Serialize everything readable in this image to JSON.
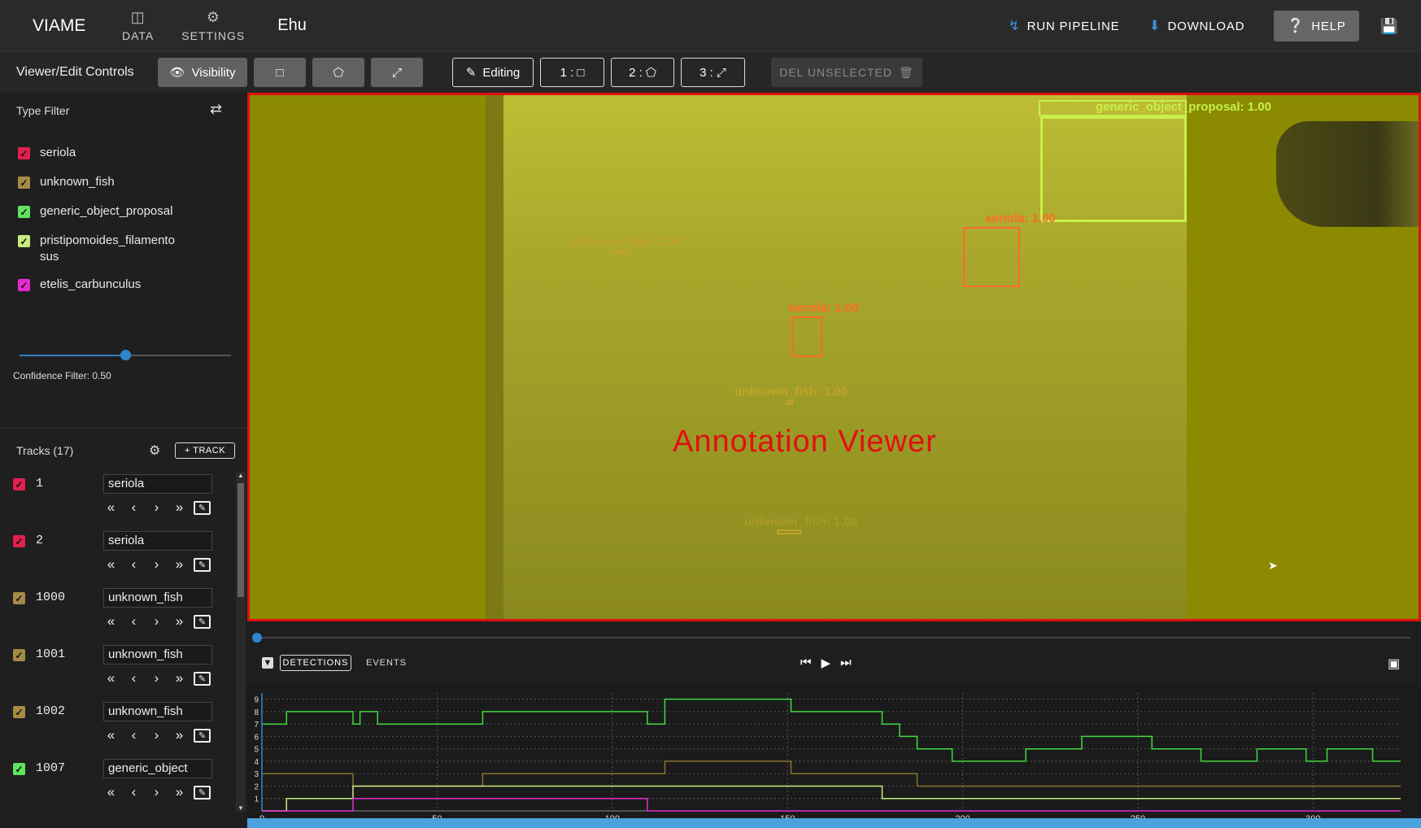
{
  "topbar": {
    "brand": "VIAME",
    "nav": [
      {
        "label": "DATA",
        "icon": "database-icon"
      },
      {
        "label": "SETTINGS",
        "icon": "gear-icon"
      }
    ],
    "dataset_name": "Ehu",
    "run_pipeline": "RUN PIPELINE",
    "download": "DOWNLOAD",
    "help": "HELP"
  },
  "controls": {
    "title": "Viewer/Edit Controls",
    "visibility": "Visibility",
    "editing": "Editing",
    "mode_1": "1 :",
    "mode_2": "2 :",
    "mode_3": "3 :",
    "delete_unselected": "DEL UNSELECTED"
  },
  "type_filter": {
    "title": "Type Filter",
    "types": [
      {
        "label": "seriola",
        "color": "#e0204f",
        "checked": true
      },
      {
        "label": "unknown_fish",
        "color": "#a58a45",
        "checked": true
      },
      {
        "label": "generic_object_proposal",
        "color": "#5fe35f",
        "checked": true
      },
      {
        "label": "pristipomoides_filamento sus",
        "color": "#c6ec7c",
        "checked": true
      },
      {
        "label": "etelis_carbunculus",
        "color": "#e62ccf",
        "checked": true
      }
    ],
    "confidence_label": "Confidence Filter: 0.50",
    "confidence_value": 0.5
  },
  "tracks": {
    "title": "Tracks (17)",
    "add_label": "+ TRACK",
    "items": [
      {
        "id": "1",
        "type": "seriola",
        "color": "#e0204f"
      },
      {
        "id": "2",
        "type": "seriola",
        "color": "#e0204f"
      },
      {
        "id": "1000",
        "type": "unknown_fish",
        "color": "#a58a45"
      },
      {
        "id": "1001",
        "type": "unknown_fish",
        "color": "#a58a45"
      },
      {
        "id": "1002",
        "type": "unknown_fish",
        "color": "#a58a45"
      },
      {
        "id": "1007",
        "type": "generic_object",
        "color": "#5fe35f"
      }
    ]
  },
  "viewer": {
    "watermark": "Annotation Viewer",
    "detections": [
      {
        "label": "generic_object_proposal: 1.00",
        "color": "#c7f04a"
      },
      {
        "label": "seriola: 1.00",
        "color": "#ff6a2b"
      },
      {
        "label": "unknown_fish: 1.00",
        "color": "#c4a22a"
      },
      {
        "label": "seriola: 1.00",
        "color": "#ff6a2b"
      },
      {
        "label": "unknown_fish: 1.00",
        "color": "#c4a22a"
      },
      {
        "label": "unknown_fish: 1.00",
        "color": "#c4a22a"
      }
    ]
  },
  "timeline": {
    "tab_detections": "DETECTIONS",
    "tab_events": "EVENTS",
    "y_ticks": [
      "1",
      "2",
      "3",
      "4",
      "5",
      "6",
      "7",
      "8",
      "9"
    ],
    "x_ticks": [
      "0",
      "50",
      "100",
      "150",
      "200",
      "250",
      "300"
    ]
  },
  "chart_data": {
    "type": "line",
    "x_range": [
      0,
      325
    ],
    "y_range": [
      0,
      9.5
    ],
    "series": [
      {
        "color": "#41d83f",
        "points": [
          [
            0,
            7
          ],
          [
            7,
            7
          ],
          [
            7,
            8
          ],
          [
            26,
            8
          ],
          [
            26,
            7
          ],
          [
            28,
            7
          ],
          [
            28,
            8
          ],
          [
            33,
            8
          ],
          [
            33,
            7
          ],
          [
            63,
            7
          ],
          [
            63,
            8
          ],
          [
            110,
            8
          ],
          [
            110,
            7
          ],
          [
            115,
            7
          ],
          [
            115,
            9
          ],
          [
            151,
            9
          ],
          [
            151,
            8
          ],
          [
            177,
            8
          ],
          [
            177,
            7
          ],
          [
            182,
            7
          ],
          [
            182,
            6
          ],
          [
            187,
            6
          ],
          [
            187,
            5
          ],
          [
            197,
            5
          ],
          [
            197,
            4
          ],
          [
            218,
            4
          ],
          [
            218,
            5
          ],
          [
            234,
            5
          ],
          [
            234,
            6
          ],
          [
            254,
            6
          ],
          [
            254,
            5
          ],
          [
            268,
            5
          ],
          [
            268,
            4
          ],
          [
            284,
            4
          ],
          [
            284,
            5
          ],
          [
            298,
            5
          ],
          [
            298,
            4
          ],
          [
            304,
            4
          ],
          [
            304,
            5
          ],
          [
            317,
            5
          ],
          [
            317,
            4
          ],
          [
            325,
            4
          ]
        ]
      },
      {
        "color": "#8a7430",
        "points": [
          [
            0,
            3
          ],
          [
            26,
            3
          ],
          [
            26,
            2
          ],
          [
            63,
            2
          ],
          [
            63,
            3
          ],
          [
            115,
            3
          ],
          [
            115,
            4
          ],
          [
            151,
            4
          ],
          [
            151,
            3
          ],
          [
            187,
            3
          ],
          [
            187,
            2
          ],
          [
            325,
            2
          ]
        ]
      },
      {
        "color": "#c6ec7c",
        "points": [
          [
            0,
            0
          ],
          [
            7,
            0
          ],
          [
            7,
            1
          ],
          [
            26,
            1
          ],
          [
            26,
            2
          ],
          [
            115,
            2
          ],
          [
            115,
            2
          ],
          [
            177,
            2
          ],
          [
            177,
            1
          ],
          [
            325,
            1
          ]
        ]
      },
      {
        "color": "#e62ccf",
        "points": [
          [
            0,
            0
          ],
          [
            26,
            0
          ],
          [
            26,
            1
          ],
          [
            110,
            1
          ],
          [
            110,
            0
          ],
          [
            325,
            0
          ]
        ]
      }
    ]
  }
}
